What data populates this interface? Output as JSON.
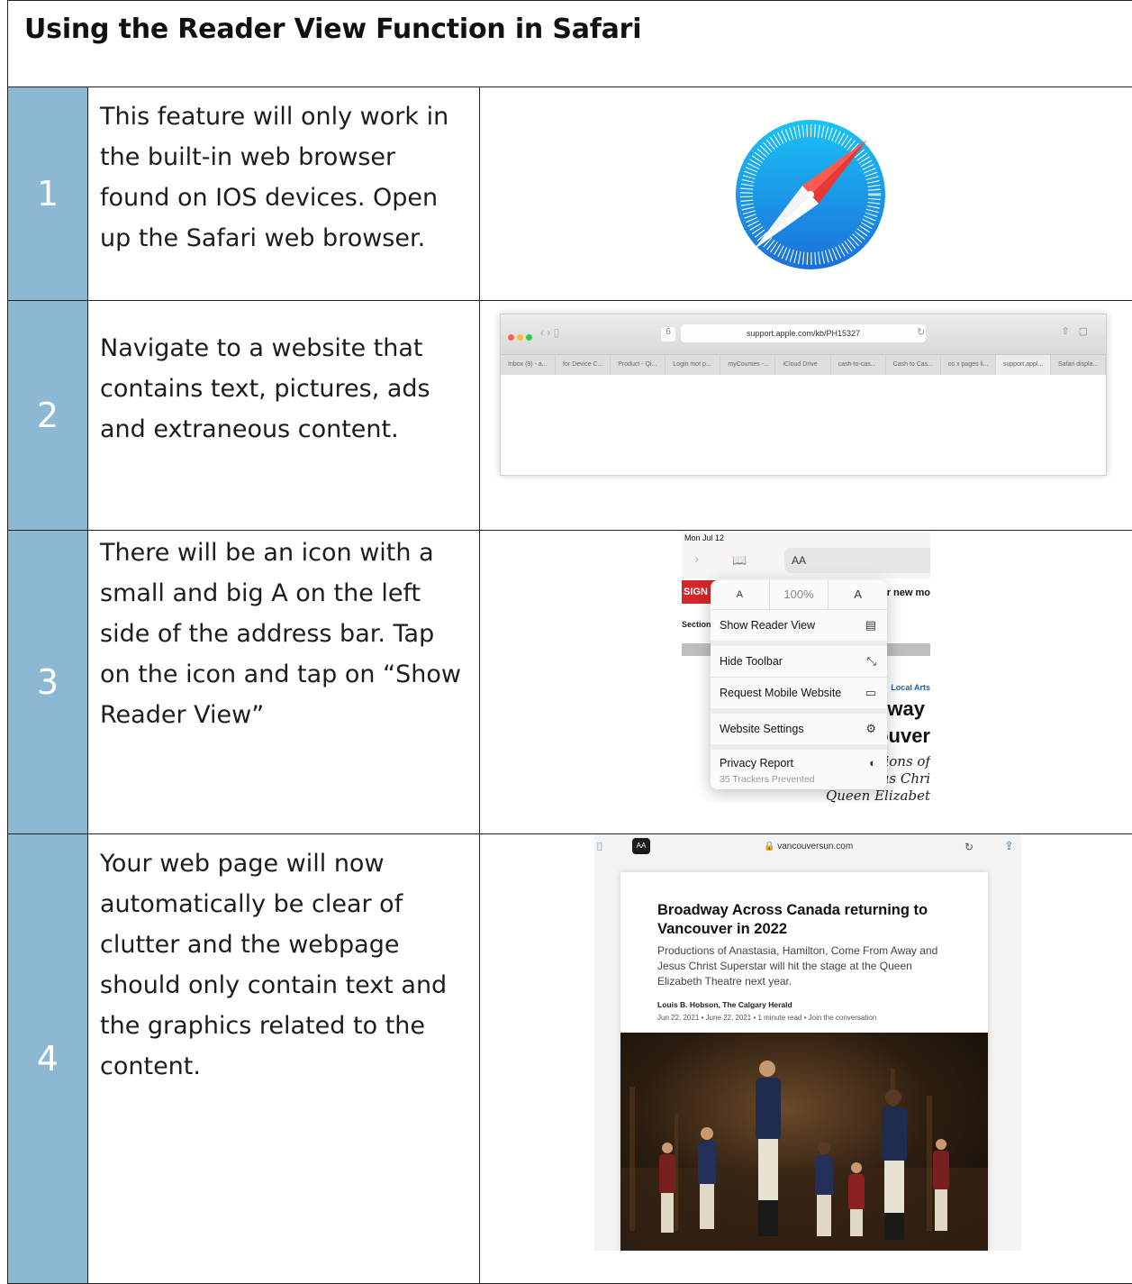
{
  "title": "Using the Reader View Function in Safari",
  "steps": [
    {
      "number": "1",
      "text": "This feature will only work in the built-in web browser found on IOS devices. Open up the Safari web browser."
    },
    {
      "number": "2",
      "text": "Navigate to a website that contains text, pictures, ads and extraneous content."
    },
    {
      "number": "3",
      "text": "There will be an icon with a small and big A on the left side of the address bar. Tap on the icon and tap on “Show Reader View”"
    },
    {
      "number": "4",
      "text": "Your web page will now automatically be clear of clutter and the webpage should only contain text and the graphics related to the content."
    }
  ],
  "browser": {
    "url": "support.apple.com/kb/PH15327",
    "tabs": [
      "Inbox (9) - a...",
      "for Device C...",
      "Product - Qi...",
      "Login mot p...",
      "myCourses -...",
      "iCloud Drive",
      "cash-to-cas...",
      "Cash to Cas...",
      "os x pages li...",
      "support.appl...",
      "Safari displa..."
    ]
  },
  "menu_shot": {
    "date": "Mon Jul 12",
    "address_label": "AA",
    "size_small": "A",
    "zoom": "100%",
    "size_big": "A",
    "items": {
      "reader": "Show Reader View",
      "toolbar": "Hide Toolbar",
      "mobile": "Request Mobile Website",
      "settings": "Website Settings",
      "privacy": "Privacy Report",
      "trackers": "35 Trackers Prevented"
    },
    "bg": {
      "sign": "SIGN",
      "newmo": "r new mo",
      "section": "Section",
      "local": "Local Arts",
      "way": "lway",
      "uver": "ouver",
      "ions": "ions of",
      "chri": "us Chri",
      "queen": "Queen Elizabet"
    }
  },
  "reader_shot": {
    "aa_label": "AA",
    "url": "vancouversun.com",
    "title": "Broadway Across Canada returning to Vancouver in 2022",
    "subtitle": "Productions of Anastasia, Hamilton, Come From Away and Jesus Christ Superstar will hit the stage at the Queen Elizabeth Theatre next year.",
    "author": "Louis B. Hobson, The Calgary Herald",
    "meta": "Jun 22, 2021  •  June 22, 2021  •  1 minute read  •  Join the conversation"
  },
  "colors": {
    "number_cell": "#8db8d4",
    "safari_blue": "#1e88e5",
    "needle_red": "#e53935"
  }
}
